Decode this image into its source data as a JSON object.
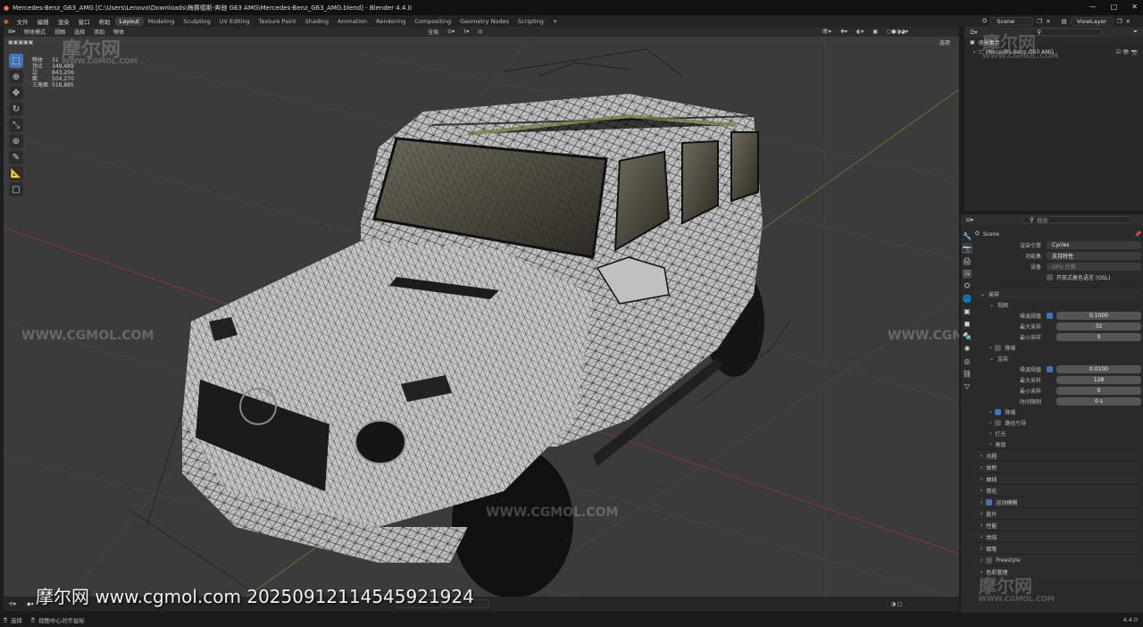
{
  "window": {
    "title": "Mercedes-Benz_G63_AMG [C:\\Users\\Lenovo\\Downloads\\梅赛德斯-奔驰 G63 AMG\\Mercedes-Benz_G63_AMG.blend] - Blender 4.4.0"
  },
  "menu": {
    "items": [
      "文件",
      "编辑",
      "渲染",
      "窗口",
      "帮助"
    ]
  },
  "workspaces": [
    "Layout",
    "Modeling",
    "Sculpting",
    "UV Editing",
    "Texture Paint",
    "Shading",
    "Animation",
    "Rendering",
    "Compositing",
    "Geometry Nodes",
    "Scripting"
  ],
  "scene_selector": "Scene",
  "viewlayer_selector": "ViewLayer",
  "viewport": {
    "mode": "物体模式",
    "menus": [
      "视图",
      "选择",
      "添加",
      "物体"
    ],
    "transform_orientation": "全局",
    "options": "选项",
    "stats": [
      {
        "label": "物体",
        "value": "31"
      },
      {
        "label": "顶点",
        "value": "349,489"
      },
      {
        "label": "边",
        "value": "843,206"
      },
      {
        "label": "面",
        "value": "504,270"
      },
      {
        "label": "三角面",
        "value": "518,885"
      }
    ]
  },
  "outliner": {
    "collection": "场景集合",
    "object": "Mercedes-Benz-G63 AMG",
    "search_placeholder": "搜索"
  },
  "properties": {
    "scene_name": "Scene",
    "render_engine_label": "渲染引擎",
    "render_engine": "Cycles",
    "feature_set_label": "功能集",
    "feature_set": "支持特性",
    "device_label": "设备",
    "device": "GPU 计算",
    "osl_label": "开放式着色语言 (OSL)",
    "sampling_label": "采样",
    "viewport_label": "视图",
    "noise_threshold_label": "噪波阈值",
    "viewport_noise_threshold": "0.1000",
    "max_samples_label": "最大采样",
    "viewport_max_samples": "32",
    "min_samples_label": "最小采样",
    "viewport_min_samples": "0",
    "denoise_label": "降噪",
    "render_label": "渲染",
    "render_noise_threshold": "0.0100",
    "render_max_samples": "128",
    "render_min_samples": "0",
    "time_limit_label": "时间限制",
    "time_limit": "0 s",
    "sub_panels": [
      {
        "label": "降噪",
        "checked": true
      },
      {
        "label": "路径引导",
        "checked": false
      },
      {
        "label": "灯光",
        "checked": null
      },
      {
        "label": "高级",
        "checked": null
      }
    ],
    "panels": [
      {
        "label": "光程",
        "checked": null
      },
      {
        "label": "体积",
        "checked": null
      },
      {
        "label": "曲线",
        "checked": null
      },
      {
        "label": "简化",
        "checked": null
      },
      {
        "label": "运动模糊",
        "checked": true
      },
      {
        "label": "胶片",
        "checked": null
      },
      {
        "label": "性能",
        "checked": null
      },
      {
        "label": "烘焙",
        "checked": null
      },
      {
        "label": "蜡笔",
        "checked": null
      },
      {
        "label": "Freestyle",
        "checked": false
      },
      {
        "label": "色彩管理",
        "checked": null
      }
    ]
  },
  "statusbar": {
    "select": "选择",
    "center_view": "视图中心对齐鼠标",
    "version": "4.4.0"
  },
  "watermarks": {
    "logo": "摩尔网",
    "url": "WWW.CGMOL.COM",
    "credit": "摩尔网 www.cgmol.com 20250912114545921924"
  },
  "colors": {
    "accent": "#4772b3",
    "background": "#3b3b3b",
    "panel": "#2a2a2a"
  }
}
